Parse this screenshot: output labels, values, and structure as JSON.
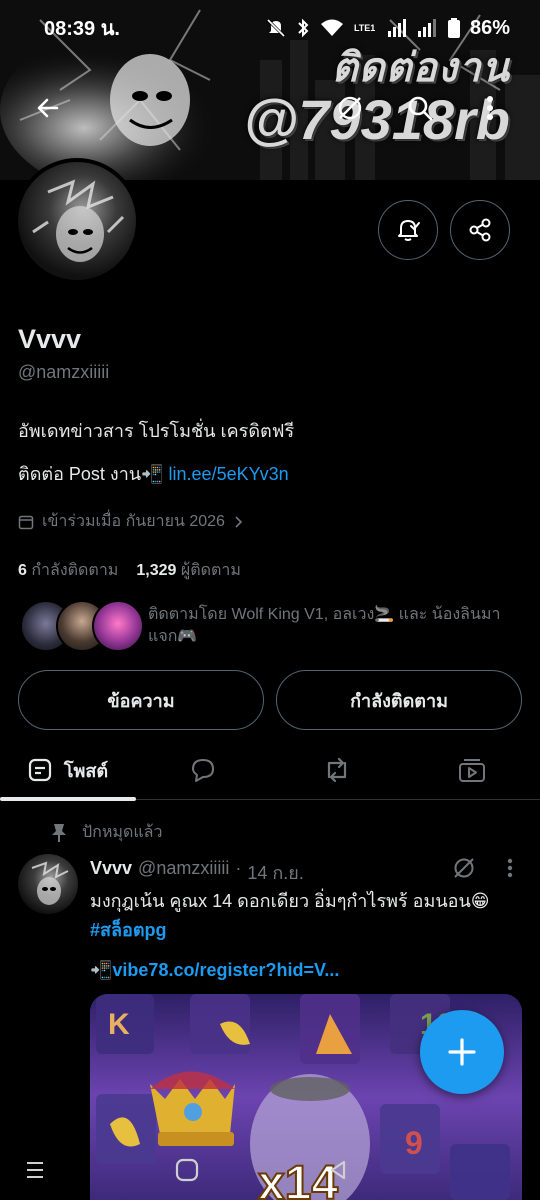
{
  "status_bar": {
    "time": "08:39 น.",
    "battery": "86%",
    "lte_label": "LTE1"
  },
  "banner": {
    "line1": "ติดต่องาน",
    "line2": "@79318rb"
  },
  "profile": {
    "name": "Vvvv",
    "handle": "@namzxiiiii",
    "bio_line1": "อัพเดทข่าวสาร โปรโมชั่น เครดิตฟรี",
    "bio_contact_label": "ติดต่อ Post งาน📲",
    "bio_contact_link": "lin.ee/5eKYv3n",
    "joined": "เข้าร่วมเมื่อ กันยายน 2026",
    "following_count": "6",
    "following_label": "กำลังติดตาม",
    "followers_count": "1,329",
    "followers_label": "ผู้ติดตาม",
    "followed_by": "ติดตามโดย Wolf King V1, อลเวง🚬 และ น้องลินมาแจก🎮"
  },
  "actions": {
    "message_label": "ข้อความ",
    "following_label": "กำลังติดตาม"
  },
  "tabs": [
    {
      "label": "โพสต์",
      "active": true
    }
  ],
  "pinned_label": "ปักหมุดแล้ว",
  "post": {
    "author": "Vvvv",
    "handle": "@namzxiiiii",
    "separator": "·",
    "date": "14 ก.ย.",
    "text": "มงกุฎเน้น คูณx 14 ดอกเดียว อิ่มๆกำไรพร้ อมนอน😁",
    "hashtag": "#สล็อตpg",
    "link": "📲vibe78.co/register?hid=V..."
  },
  "icons": {
    "back": "back-arrow-icon",
    "grok": "grok-icon",
    "search": "search-icon",
    "more": "more-icon",
    "notify": "bell-check-icon",
    "share": "share-icon",
    "calendar": "calendar-icon",
    "pin": "pin-icon",
    "fab": "plus-icon"
  },
  "colors": {
    "accent": "#1d9bf0",
    "muted": "#71767b",
    "text": "#e7e9ea",
    "border": "#536471",
    "bg": "#000000"
  }
}
